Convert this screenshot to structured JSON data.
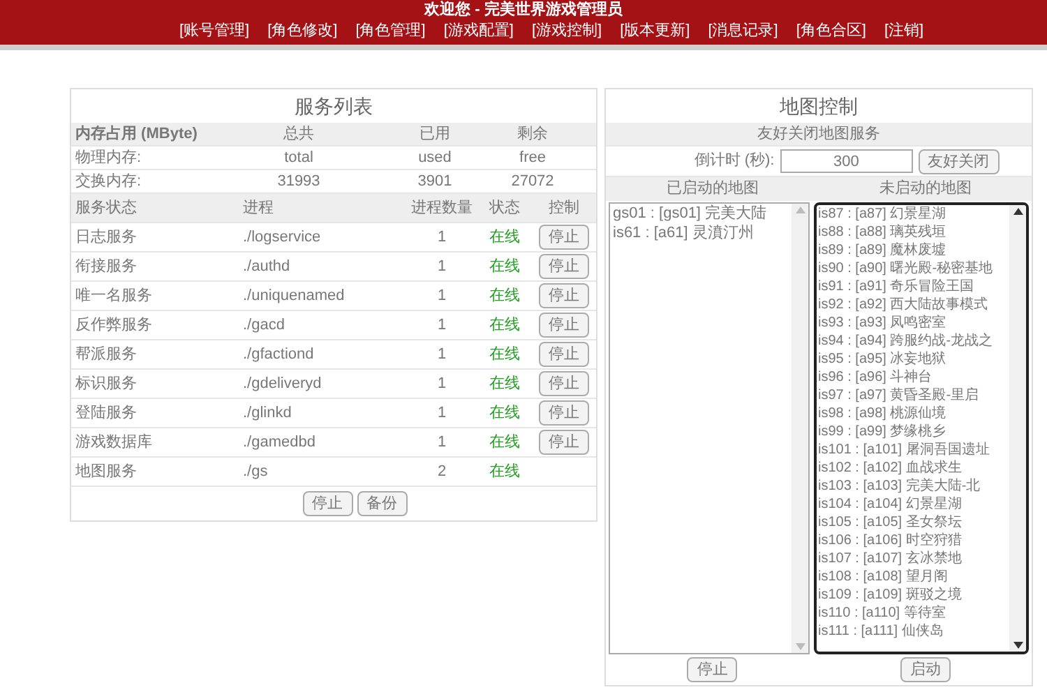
{
  "header": {
    "title": "欢迎您 - 完美世界游戏管理员",
    "nav": [
      "[账号管理]",
      "[角色修改]",
      "[角色管理]",
      "[游戏配置]",
      "[游戏控制]",
      "[版本更新]",
      "[消息记录]",
      "[角色合区]",
      "[注销]"
    ]
  },
  "service_panel": {
    "title": "服务列表",
    "memory_columns": [
      "内存占用 (MByte)",
      "总共",
      "已用",
      "剩余"
    ],
    "memory_rows": [
      [
        "物理内存:",
        "total",
        "used",
        "free"
      ],
      [
        "交换内存:",
        "31993",
        "3901",
        "27072"
      ]
    ],
    "service_columns": [
      "服务状态",
      "进程",
      "进程数量",
      "状态",
      "控制"
    ],
    "services": [
      {
        "name": "日志服务",
        "process": "./logservice",
        "count": "1",
        "status": "在线",
        "button": "停止"
      },
      {
        "name": "衔接服务",
        "process": "./authd",
        "count": "1",
        "status": "在线",
        "button": "停止"
      },
      {
        "name": "唯一名服务",
        "process": "./uniquenamed",
        "count": "1",
        "status": "在线",
        "button": "停止"
      },
      {
        "name": "反作弊服务",
        "process": "./gacd",
        "count": "1",
        "status": "在线",
        "button": "停止"
      },
      {
        "name": "帮派服务",
        "process": "./gfactiond",
        "count": "1",
        "status": "在线",
        "button": "停止"
      },
      {
        "name": "标识服务",
        "process": "./gdeliveryd",
        "count": "1",
        "status": "在线",
        "button": "停止"
      },
      {
        "name": "登陆服务",
        "process": "./glinkd",
        "count": "1",
        "status": "在线",
        "button": "停止"
      },
      {
        "name": "游戏数据库",
        "process": "./gamedbd",
        "count": "1",
        "status": "在线",
        "button": "停止"
      },
      {
        "name": "地图服务",
        "process": "./gs",
        "count": "2",
        "status": "在线"
      }
    ],
    "footer_buttons": [
      "停止",
      "备份"
    ]
  },
  "map_panel": {
    "title": "地图控制",
    "subtitle": "友好关闭地图服务",
    "countdown_label": "倒计时 (秒):",
    "countdown_value": "300",
    "close_button": "友好关闭",
    "started_heading": "已启动的地图",
    "stopped_heading": "未启动的地图",
    "started_maps": [
      "gs01 : [gs01] 完美大陆",
      "is61 : [a61] 灵濆汀州"
    ],
    "stopped_maps": [
      "is87 : [a87] 幻景星湖",
      "is88 : [a88] 璃英残垣",
      "is89 : [a89] 魔林废墟",
      "is90 : [a90] 曙光殿-秘密基地",
      "is91 : [a91] 奇乐冒险王国",
      "is92 : [a92] 西大陆故事模式",
      "is93 : [a93] 凤鸣密室",
      "is94 : [a94] 跨服约战-龙战之",
      "is95 : [a95] 冰妄地狱",
      "is96 : [a96] 斗神台",
      "is97 : [a97] 黄昏圣殿-里启",
      "is98 : [a98] 桃源仙境",
      "is99 : [a99] 梦缘桃乡",
      "is101 : [a101] 屠洞吾国遗址",
      "is102 : [a102] 血战求生",
      "is103 : [a103] 完美大陆-北",
      "is104 : [a104] 幻景星湖",
      "is105 : [a105] 圣女祭坛",
      "is106 : [a106] 时空狩猎",
      "is107 : [a107] 玄冰禁地",
      "is108 : [a108] 望月阁",
      "is109 : [a109] 斑驳之境",
      "is110 : [a110] 等待室",
      "is111 : [a111] 仙侠岛"
    ],
    "stop_button": "停止",
    "start_button": "启动"
  }
}
